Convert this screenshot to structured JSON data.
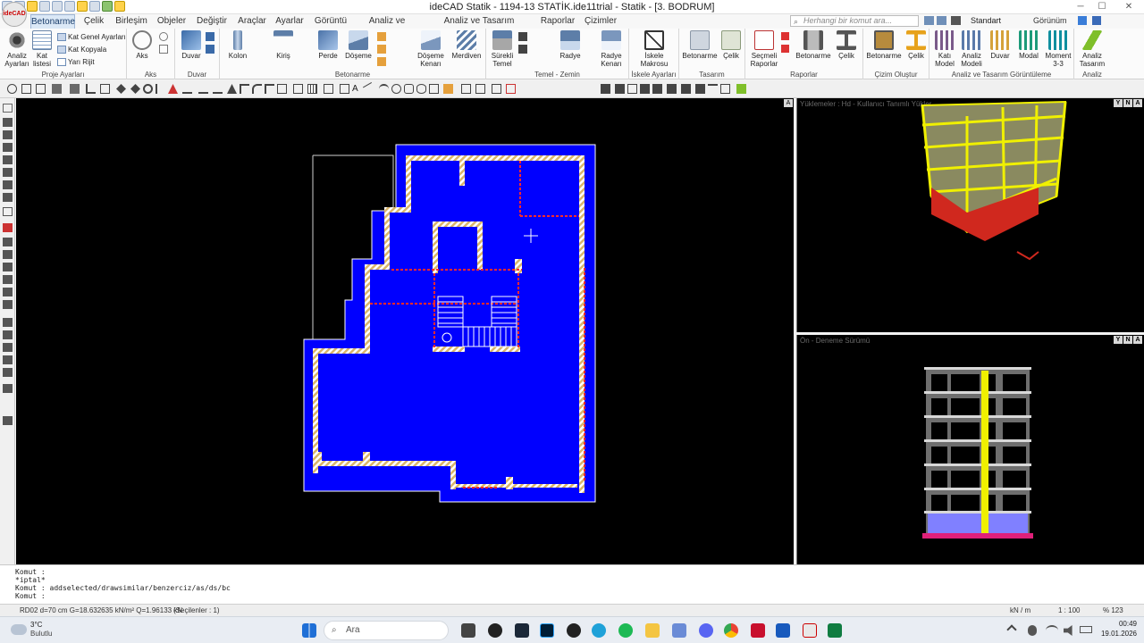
{
  "titlebar": {
    "title": "ideCAD Statik - 1194-13 STATİK.ide11trial - Statik - [3. BODRUM]",
    "buttons": {
      "minimize": "─",
      "maximize": "☐",
      "close": "✕"
    }
  },
  "tabs": {
    "logo": "ideCAD",
    "items": [
      "Betonarme",
      "Çelik",
      "Birleşim",
      "Objeler",
      "Değiştir",
      "Araçlar",
      "Ayarlar",
      "Görüntü",
      "Analiz ve Tasarım",
      "Analiz ve Tasarım Görüntüleme",
      "Raporlar",
      "Çizimler"
    ],
    "search_placeholder": "Herhangi bir komut ara...",
    "standard_label": "Standart",
    "view_label": "Görünüm"
  },
  "ribbon": {
    "groups": {
      "proje_ayarlari": "Proje Ayarları",
      "aks": "Aks",
      "duvar": "Duvar",
      "betonarme": "Betonarme",
      "temel_zemin": "Temel - Zemin",
      "iskele_ayarlari": "İskele Ayarları",
      "tasarim": "Tasarım",
      "raporlar": "Raporlar",
      "cizim_olustur": "Çizim Oluştur",
      "analiz_tasarim_goruntuleme": "Analiz ve Tasarım Görüntüleme",
      "analiz": "Analiz"
    },
    "buttons": {
      "analiz_ayarlari": "Analiz Ayarları",
      "kat_listesi": "Kat listesi",
      "kat_genel_ayarlari": "Kat Genel Ayarları",
      "kat_kopyala": "Kat Kopyala",
      "yari_rijit": "Yarı Rijit",
      "aks": "Aks",
      "duvar": "Duvar",
      "kolon": "Kolon",
      "kiris": "Kiriş",
      "perde": "Perde",
      "doseme": "Döşeme",
      "doseme_kenari": "Döşeme Kenarı",
      "merdiven": "Merdiven",
      "surekli_temel": "Sürekli Temel",
      "radye": "Radye",
      "radye_kenari": "Radye Kenarı",
      "iskele_makrosu": "İskele Makrosu",
      "betonarme_t": "Betonarme",
      "celik_t": "Çelik",
      "secmeli_raporlar": "Seçmeli Raporlar",
      "betonarme_r": "Betonarme",
      "celik_r": "Çelik",
      "betonarme_c": "Betonarme",
      "celik_c": "Çelik",
      "kati_model": "Katı Model",
      "analiz_modeli": "Analiz Modeli",
      "duvar_g": "Duvar",
      "modal": "Modal",
      "moment": "Moment 3-3",
      "analiz_tasarim": "Analiz Tasarım"
    }
  },
  "viewports": {
    "plan_control": "A",
    "top_right_title": "Yüklemeler : Hd - Kullanıcı Tanımlı Yükler",
    "bottom_right_title": "Ön - Deneme Sürümü",
    "ctrl_labels": [
      "Y",
      "N",
      "A"
    ]
  },
  "command": {
    "lines": [
      "Komut :",
      "*iptal*",
      "Komut : addselected/drawsimilar/benzerciz/as/ds/bc",
      "Komut :"
    ]
  },
  "statusbar": {
    "info": "RD02 d=70 cm G=18.632635 kN/m² Q=1.96133 kN",
    "selected": "(Seçilenler : 1)",
    "unit": "kN / m",
    "scale": "1 : 100",
    "zoom": "% 123"
  },
  "taskbar": {
    "weather_temp": "3°C",
    "weather_desc": "Bulutlu",
    "search_label": "Ara",
    "time": "00:49",
    "date": "19.01.2026"
  },
  "colors": {
    "slab_fill": "#0000ff",
    "wall_hatch": "#ffe0a0",
    "beam_red": "#ff2a2a",
    "frame_yellow": "#f0f000",
    "background_black": "#000000"
  }
}
